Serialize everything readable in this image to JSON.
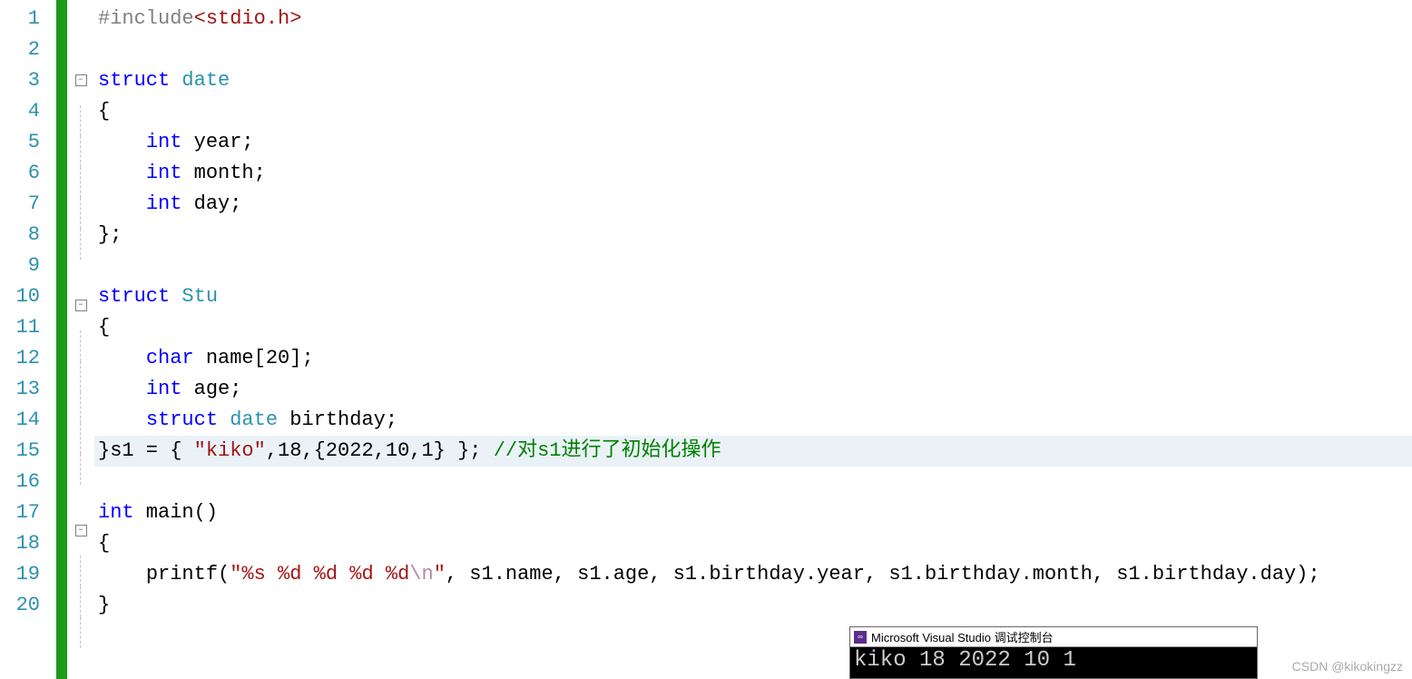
{
  "lines": {
    "count": 20,
    "l1": {
      "preproc": "#include",
      "header": "<stdio.h>"
    },
    "l3": {
      "kw": "struct",
      "type": " date"
    },
    "l4": {
      "brace": "{"
    },
    "l5": {
      "indent": "    ",
      "kw": "int",
      "ident": " year;"
    },
    "l6": {
      "indent": "    ",
      "kw": "int",
      "ident": " month;"
    },
    "l7": {
      "indent": "    ",
      "kw": "int",
      "ident": " day;"
    },
    "l8": {
      "brace": "};"
    },
    "l10": {
      "kw": "struct",
      "type": " Stu"
    },
    "l11": {
      "brace": "{"
    },
    "l12": {
      "indent": "    ",
      "kw": "char",
      "ident": " name[20];"
    },
    "l13": {
      "indent": "    ",
      "kw": "int",
      "ident": " age;"
    },
    "l14": {
      "indent": "    ",
      "kw": "struct",
      "type": " date",
      "ident": " birthday;"
    },
    "l15": {
      "prefix": "}s1 = { ",
      "str": "\"kiko\"",
      "mid": ",18,{2022,10,1} }; ",
      "comment": "//对s1进行了初始化操作"
    },
    "l17": {
      "kw": "int",
      "func": " main",
      "paren": "()"
    },
    "l18": {
      "brace": "{"
    },
    "l19": {
      "indent": "    ",
      "func": "printf",
      "p1": "(",
      "s1": "\"%s %d %d %d %d",
      "esc": "\\n",
      "s2": "\"",
      "args": ", s1.name, s1.age, s1.birthday.year, s1.birthday.month, s1.birthday.day);"
    },
    "l20": {
      "brace": "}"
    }
  },
  "lineNumbers": [
    "1",
    "2",
    "3",
    "4",
    "5",
    "6",
    "7",
    "8",
    "9",
    "10",
    "11",
    "12",
    "13",
    "14",
    "15",
    "16",
    "17",
    "18",
    "19",
    "20"
  ],
  "console": {
    "title": "Microsoft Visual Studio 调试控制台",
    "output": "kiko 18 2022 10 1"
  },
  "watermark": "CSDN @kikokingzz"
}
